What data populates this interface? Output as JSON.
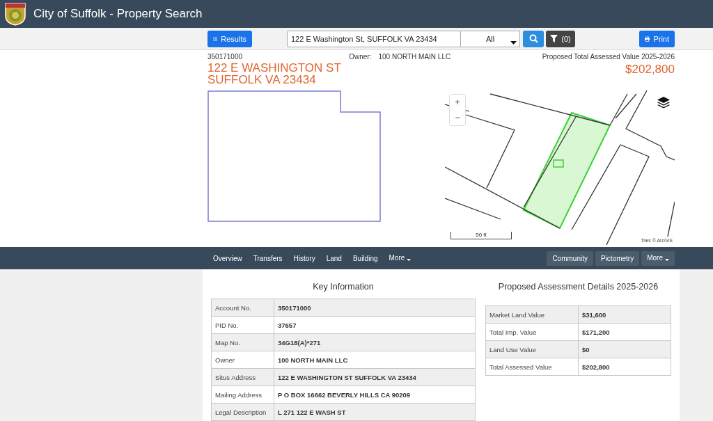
{
  "header": {
    "title": "City of Suffolk - Property Search"
  },
  "toolbar": {
    "results_button": "Results",
    "search": {
      "value": "122 E Washington St, SUFFOLK VA 23434"
    },
    "scope": {
      "value": "All"
    },
    "filter_button": "(0)",
    "print_button": "Print"
  },
  "summary": {
    "account": "350171000",
    "address_lines": [
      "122 E WASHINGTON ST",
      "SUFFOLK VA 23434"
    ],
    "owner_label": "Owner:",
    "owner": "100 NORTH MAIN LLC",
    "value_label": "Proposed Total Assessed Value 2025-2026",
    "value": "$202,800"
  },
  "map": {
    "zoom_in": "+",
    "zoom_out": "−",
    "scale": "50 ft",
    "attribution": "Tiles © ArcGIS"
  },
  "nav": {
    "tabs": [
      {
        "label": "Overview",
        "kind": "link"
      },
      {
        "label": "Transfers",
        "kind": "link"
      },
      {
        "label": "History",
        "kind": "link"
      },
      {
        "label": "Land",
        "kind": "link"
      },
      {
        "label": "Building",
        "kind": "link"
      },
      {
        "label": "More",
        "kind": "dropdown"
      }
    ],
    "buttons": [
      {
        "label": "Community",
        "kind": "button"
      },
      {
        "label": "Pictometry",
        "kind": "button"
      },
      {
        "label": "More",
        "kind": "dropdown"
      }
    ]
  },
  "key_info": {
    "title": "Key Information",
    "rows": [
      {
        "label": "Account No.",
        "value": "350171000"
      },
      {
        "label": "PID No.",
        "value": "37657"
      },
      {
        "label": "Map No.",
        "value": "34G18(A)*271"
      },
      {
        "label": "Owner",
        "value": "100 NORTH MAIN LLC"
      },
      {
        "label": "Situs Address",
        "value": "122 E WASHINGTON ST SUFFOLK VA 23434"
      },
      {
        "label": "Mailing Address",
        "value": "P O BOX 16662 BEVERLY HILLS CA 90209"
      },
      {
        "label": "Legal Description",
        "value": "L 271 122 E WASH ST"
      }
    ]
  },
  "assessment": {
    "title": "Proposed Assessment Details 2025-2026",
    "rows": [
      {
        "label": "Market Land Value",
        "value": "$31,600"
      },
      {
        "label": "Total Imp. Value",
        "value": "$171,200"
      },
      {
        "label": "Land Use Value",
        "value": "$0"
      },
      {
        "label": "Total Assessed Value",
        "value": "$202,800"
      }
    ]
  }
}
